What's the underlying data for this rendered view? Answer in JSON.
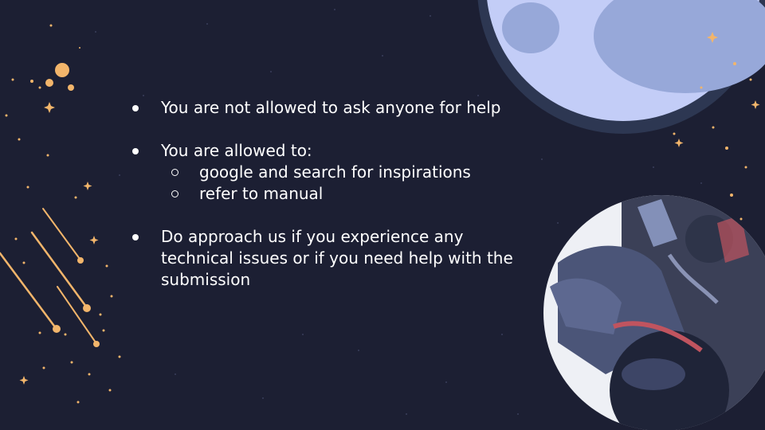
{
  "slide": {
    "bullets": {
      "b1": "You are not allowed to ask anyone for help",
      "b2": "You are allowed to:",
      "b2_sub": [
        "google and search for inspirations",
        "refer to manual"
      ],
      "b3": "Do approach us if you experience any technical issues or if you need help with the submission"
    }
  },
  "colors": {
    "background": "#1c1f33",
    "moon": "#c3cdf7",
    "moon_crater": "#97a8d9",
    "moon_rim": "#2d3752",
    "star": "#f2b56b",
    "text": "#ffffff"
  },
  "icons": [
    "moon-icon",
    "meteor-icon",
    "star-icon",
    "astronaut-image"
  ]
}
